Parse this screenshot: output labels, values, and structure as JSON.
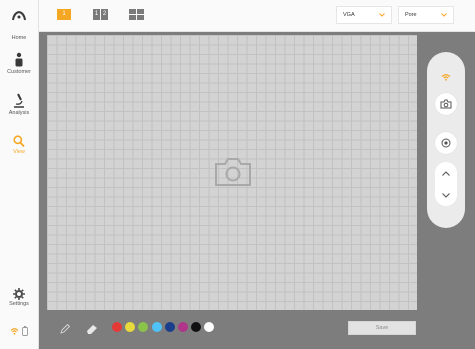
{
  "sidebar": {
    "items": [
      {
        "label": "",
        "icon": "logo-icon"
      },
      {
        "label": "Home",
        "icon": "home-icon"
      },
      {
        "label": "Customer",
        "icon": "customer-icon"
      },
      {
        "label": "Analysis",
        "icon": "microscope-icon"
      },
      {
        "label": "View",
        "icon": "search-icon"
      },
      {
        "label": "Settings",
        "icon": "gear-icon"
      }
    ],
    "active": "View"
  },
  "topbar": {
    "layouts": [
      {
        "cells": [
          "1"
        ],
        "active": true
      },
      {
        "cells": [
          "1",
          "2"
        ],
        "active": false
      },
      {
        "cells": [
          "",
          "",
          "",
          ""
        ],
        "active": false
      }
    ],
    "resolution": "VGA",
    "mode": "Pore"
  },
  "panel": {
    "buttons": [
      "wifi-icon",
      "camera-icon",
      "record-icon",
      "chevron-up-icon",
      "chevron-down-icon"
    ]
  },
  "toolbar": {
    "tools": [
      "pen-icon",
      "eraser-icon"
    ],
    "colors": [
      "#e53935",
      "#e8d93c",
      "#8bc34a",
      "#4fc3f7",
      "#1a3e8c",
      "#b0348a",
      "#111111",
      "#ffffff"
    ],
    "save_label": "Save"
  },
  "status": {
    "icons": [
      "wifi-icon",
      "battery-icon"
    ]
  },
  "colors": {
    "accent": "#f5a623",
    "background": "#7d7d7d",
    "canvas": "#d3d3d3"
  }
}
